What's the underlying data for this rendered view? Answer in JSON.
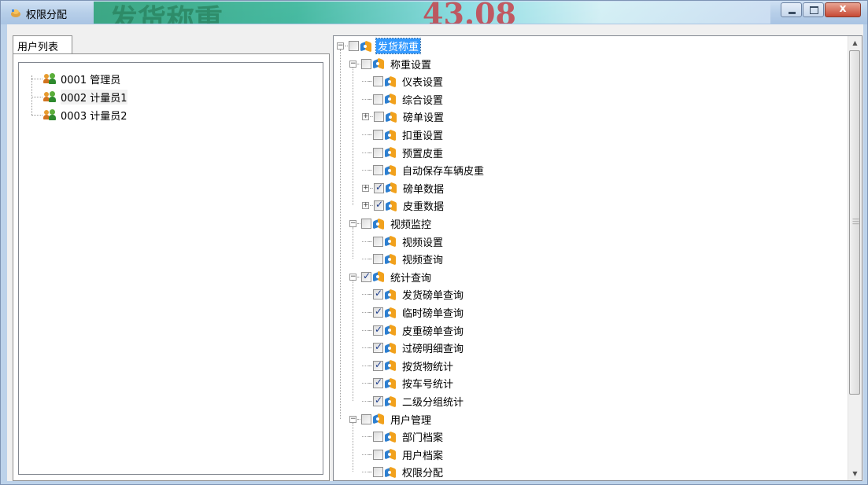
{
  "window": {
    "title": "权限分配"
  },
  "banner": {
    "left_text": "发货称重",
    "right_text": "43.08"
  },
  "left_panel": {
    "tab_label": "用户列表",
    "users": [
      {
        "label": "0001 管理员"
      },
      {
        "label": "0002 计量员1",
        "selected": true
      },
      {
        "label": "0003 计量员2"
      }
    ]
  },
  "tree": {
    "nodes": [
      {
        "label": "发货称重",
        "level": 0,
        "expander": "minus",
        "checked": false,
        "selected": true
      },
      {
        "label": "称重设置",
        "level": 1,
        "expander": "minus",
        "checked": false
      },
      {
        "label": "仪表设置",
        "level": 2,
        "checked": false
      },
      {
        "label": "综合设置",
        "level": 2,
        "checked": false
      },
      {
        "label": "磅单设置",
        "level": 2,
        "expander": "plus",
        "checked": false
      },
      {
        "label": "扣重设置",
        "level": 2,
        "checked": false
      },
      {
        "label": "预置皮重",
        "level": 2,
        "checked": false
      },
      {
        "label": "自动保存车辆皮重",
        "level": 2,
        "checked": false
      },
      {
        "label": "磅单数据",
        "level": 2,
        "expander": "plus",
        "checked": true
      },
      {
        "label": "皮重数据",
        "level": 2,
        "expander": "plus",
        "checked": true
      },
      {
        "label": "视频监控",
        "level": 1,
        "expander": "minus",
        "checked": false
      },
      {
        "label": "视频设置",
        "level": 2,
        "checked": false
      },
      {
        "label": "视频查询",
        "level": 2,
        "checked": false
      },
      {
        "label": "统计查询",
        "level": 1,
        "expander": "minus",
        "checked": true
      },
      {
        "label": "发货磅单查询",
        "level": 2,
        "checked": true
      },
      {
        "label": "临时磅单查询",
        "level": 2,
        "checked": true
      },
      {
        "label": "皮重磅单查询",
        "level": 2,
        "checked": true
      },
      {
        "label": "过磅明细查询",
        "level": 2,
        "checked": true
      },
      {
        "label": "按货物统计",
        "level": 2,
        "checked": true
      },
      {
        "label": "按车号统计",
        "level": 2,
        "checked": true
      },
      {
        "label": "二级分组统计",
        "level": 2,
        "checked": true
      },
      {
        "label": "用户管理",
        "level": 1,
        "expander": "minus",
        "checked": false
      },
      {
        "label": "部门档案",
        "level": 2,
        "checked": false
      },
      {
        "label": "用户档案",
        "level": 2,
        "checked": false
      },
      {
        "label": "权限分配",
        "level": 2,
        "checked": false
      }
    ]
  },
  "colors": {
    "selection": "#3399ff",
    "title_bar": "#b7cfe9",
    "close_button": "#c74a35"
  }
}
